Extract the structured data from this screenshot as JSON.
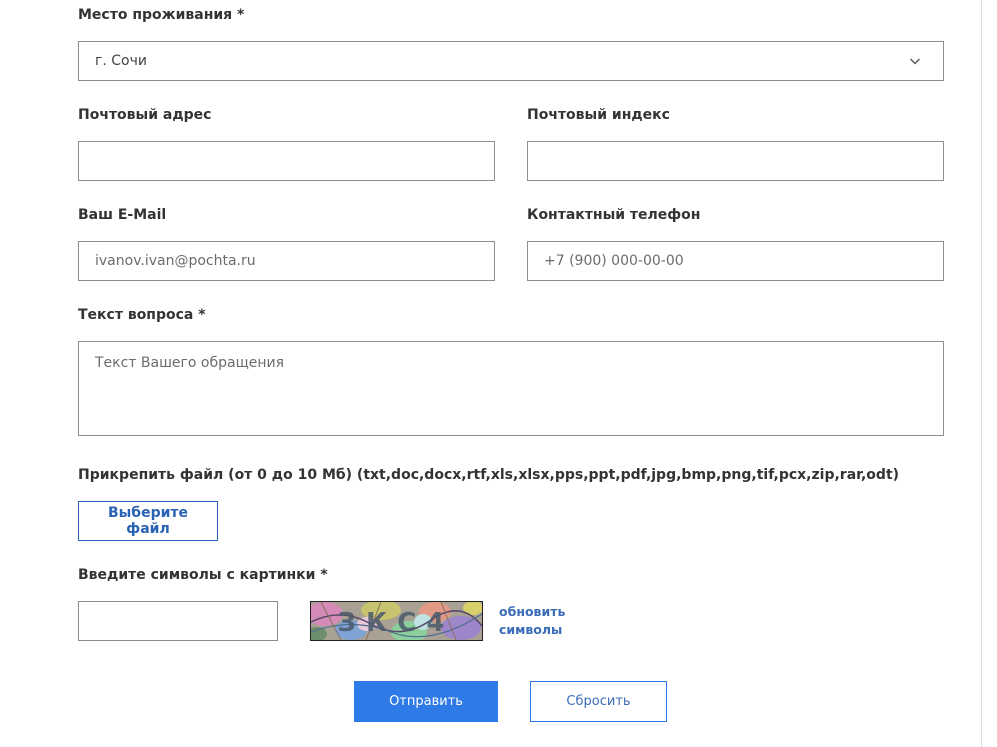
{
  "form": {
    "residence": {
      "label": "Место проживания *",
      "value": "г. Сочи"
    },
    "postal_address": {
      "label": "Почтовый адрес",
      "value": "",
      "placeholder": ""
    },
    "postal_index": {
      "label": "Почтовый индекс",
      "value": "",
      "placeholder": ""
    },
    "email": {
      "label": "Ваш E-Mail",
      "placeholder": "ivanov.ivan@pochta.ru"
    },
    "phone": {
      "label": "Контактный телефон",
      "placeholder": "+7 (900) 000-00-00"
    },
    "question": {
      "label": "Текст вопроса *",
      "placeholder": "Текст Вашего обращения"
    },
    "attachment": {
      "label": "Прикрепить файл (от 0 до 10 Мб) (txt,doc,docx,rtf,xls,xlsx,pps,ppt,pdf,jpg,bmp,png,tif,pcx,zip,rar,odt)",
      "button_label": "Выберите файл"
    },
    "captcha": {
      "label": "Введите символы с картинки *",
      "value": "",
      "image_text": "ЗКС4",
      "refresh_line1": "обновить",
      "refresh_line2": "символы"
    },
    "actions": {
      "submit_label": "Отправить",
      "reset_label": "Сбросить"
    }
  },
  "colors": {
    "accent": "#2e7ae6",
    "link": "#3a6db8",
    "border": "#8e8e8e"
  },
  "icons": {
    "select_arrow": "chevron-down-icon"
  }
}
